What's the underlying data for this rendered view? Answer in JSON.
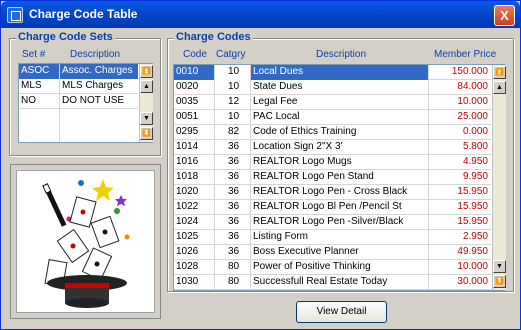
{
  "window": {
    "title": "Charge Code Table",
    "close_label": "X"
  },
  "charge_code_sets": {
    "title": "Charge Code Sets",
    "headers": {
      "set": "Set #",
      "description": "Description"
    },
    "rows": [
      {
        "set": "ASOC",
        "description": "Assoc. Charges"
      },
      {
        "set": "MLS",
        "description": "MLS Charges"
      },
      {
        "set": "NO",
        "description": "DO NOT USE"
      }
    ]
  },
  "charge_codes": {
    "title": "Charge Codes",
    "headers": {
      "code": "Code",
      "category": "Catgry",
      "description": "Description",
      "price": "Member Price"
    },
    "rows": [
      {
        "code": "0010",
        "category": "10",
        "description": "Local Dues",
        "price": "150.000"
      },
      {
        "code": "0020",
        "category": "10",
        "description": "State Dues",
        "price": "84.000"
      },
      {
        "code": "0035",
        "category": "12",
        "description": "Legal Fee",
        "price": "10.000"
      },
      {
        "code": "0051",
        "category": "10",
        "description": "PAC Local",
        "price": "25.000"
      },
      {
        "code": "0295",
        "category": "82",
        "description": "Code of Ethics Training",
        "price": "0.000"
      },
      {
        "code": "1014",
        "category": "36",
        "description": "Location Sign 2\"X 3'",
        "price": "5.800"
      },
      {
        "code": "1016",
        "category": "36",
        "description": "REALTOR Logo Mugs",
        "price": "4.950"
      },
      {
        "code": "1018",
        "category": "36",
        "description": "REALTOR Logo Pen Stand",
        "price": "9.950"
      },
      {
        "code": "1020",
        "category": "36",
        "description": "REALTOR Logo Pen - Cross Black",
        "price": "15.950"
      },
      {
        "code": "1022",
        "category": "36",
        "description": "REALTOR Logo Bl Pen /Pencil St",
        "price": "15.950"
      },
      {
        "code": "1024",
        "category": "36",
        "description": "REALTOR Logo Pen -Silver/Black",
        "price": "15.950"
      },
      {
        "code": "1025",
        "category": "36",
        "description": "Listing Form",
        "price": "2.950"
      },
      {
        "code": "1026",
        "category": "36",
        "description": "Boss Executive Planner",
        "price": "49.950"
      },
      {
        "code": "1028",
        "category": "80",
        "description": "Power of Positive Thinking",
        "price": "10.000"
      },
      {
        "code": "1030",
        "category": "80",
        "description": "Successfull Real Estate Today",
        "price": "30.000"
      }
    ]
  },
  "view_detail_label": "View Detail",
  "icons": {
    "scroll_top": "scroll-top-icon",
    "scroll_up": "scroll-up-icon",
    "scroll_down": "scroll-down-icon",
    "scroll_bottom": "scroll-bottom-icon"
  }
}
